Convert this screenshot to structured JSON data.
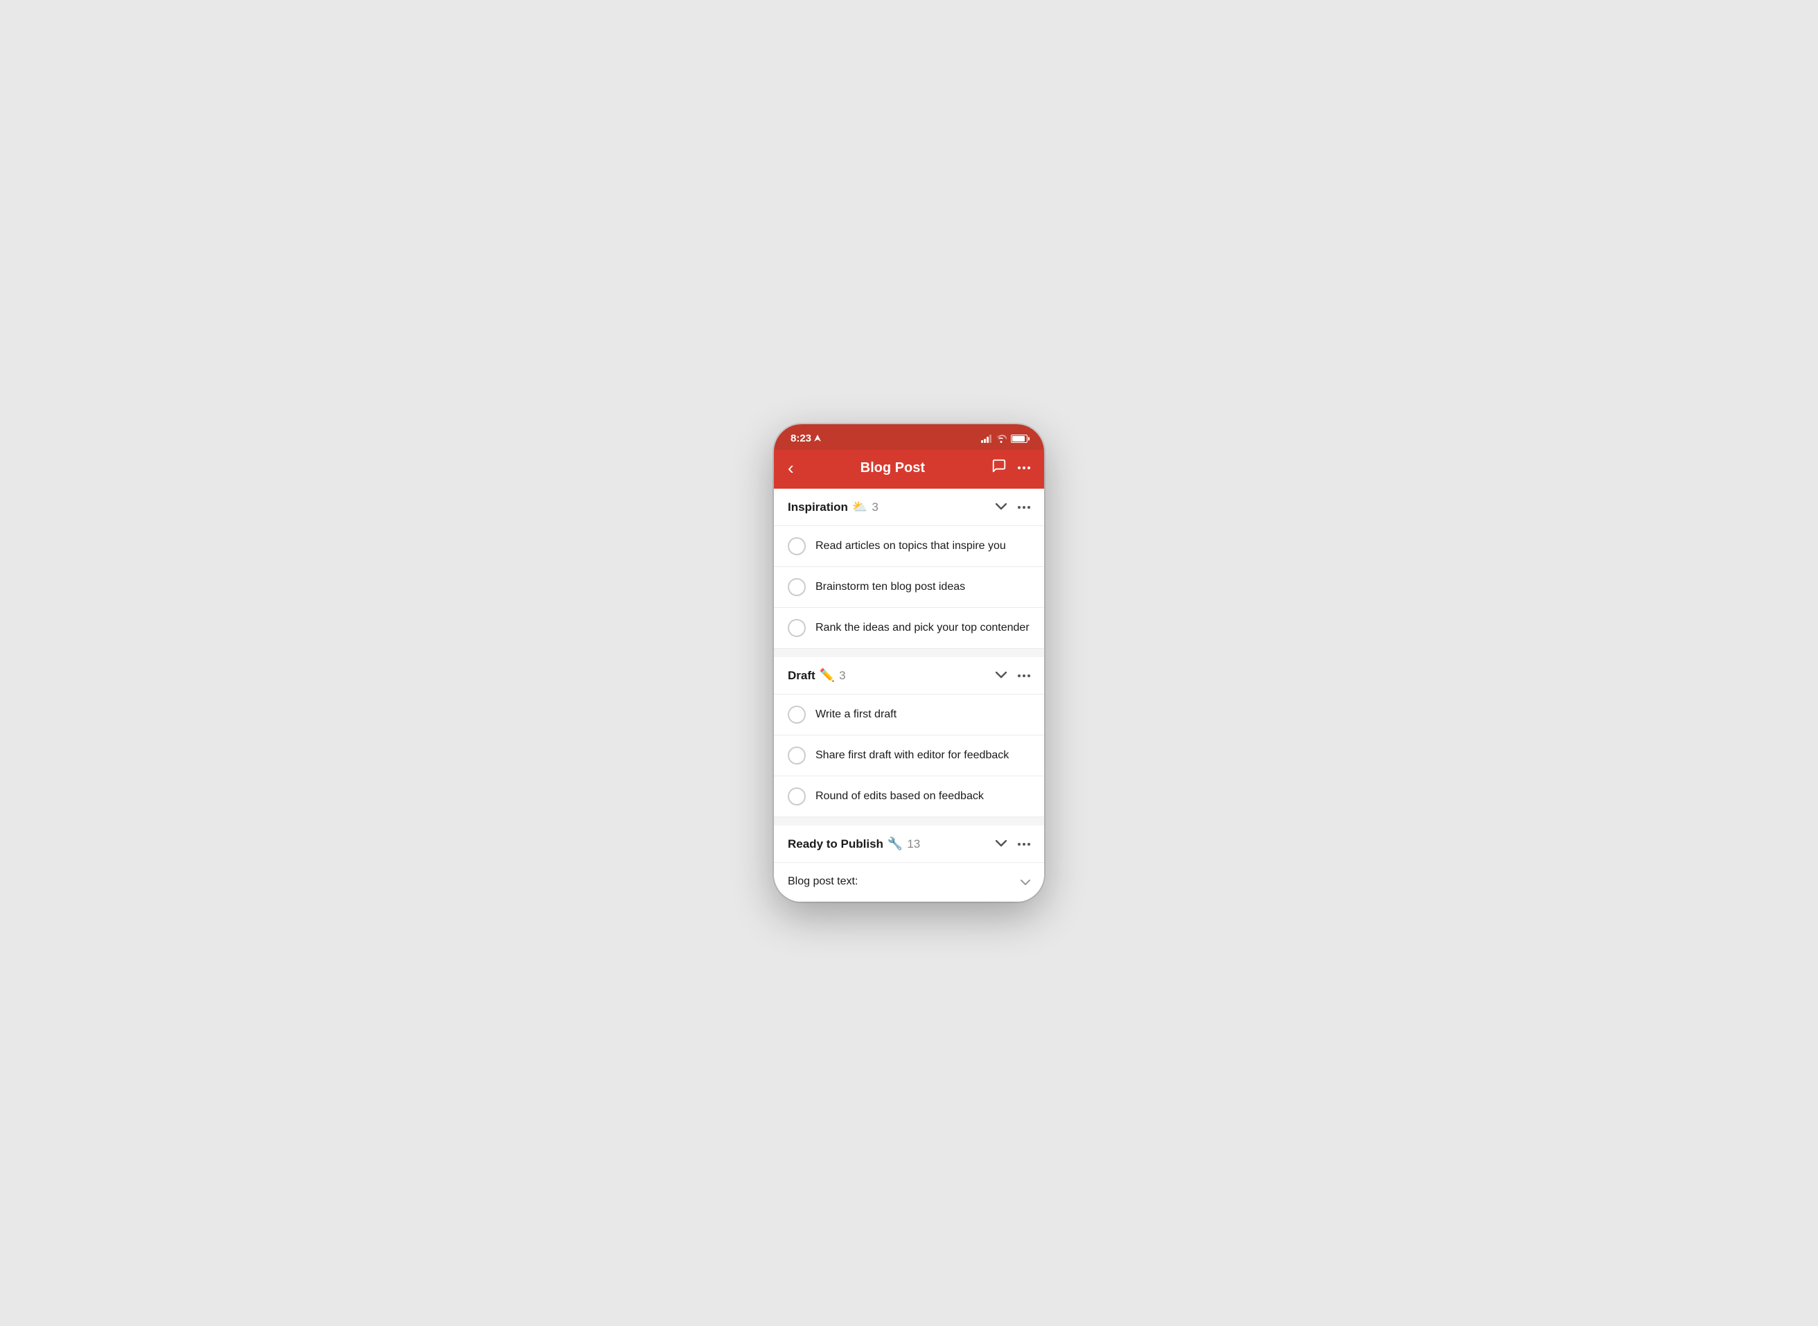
{
  "statusBar": {
    "time": "8:23",
    "locationArrow": "◂"
  },
  "navBar": {
    "backLabel": "‹",
    "title": "Blog Post",
    "commentIcon": "💬",
    "moreLabel": "···"
  },
  "sections": [
    {
      "id": "inspiration",
      "title": "Inspiration",
      "emoji": "⛅",
      "count": "3",
      "tasks": [
        {
          "id": "t1",
          "text": "Read articles on topics that inspire you"
        },
        {
          "id": "t2",
          "text": "Brainstorm ten blog post ideas"
        },
        {
          "id": "t3",
          "text": "Rank the ideas and pick your top contender"
        }
      ]
    },
    {
      "id": "draft",
      "title": "Draft",
      "emoji": "✏️",
      "count": "3",
      "tasks": [
        {
          "id": "t4",
          "text": "Write a first draft"
        },
        {
          "id": "t5",
          "text": "Share first draft with editor for feedback"
        },
        {
          "id": "t6",
          "text": "Round of edits based on feedback"
        }
      ]
    },
    {
      "id": "readyToPublish",
      "title": "Ready to Publish",
      "emoji": "🔧",
      "count": "13",
      "tasks": [
        {
          "id": "t7",
          "text": "Blog post text:"
        }
      ]
    }
  ]
}
